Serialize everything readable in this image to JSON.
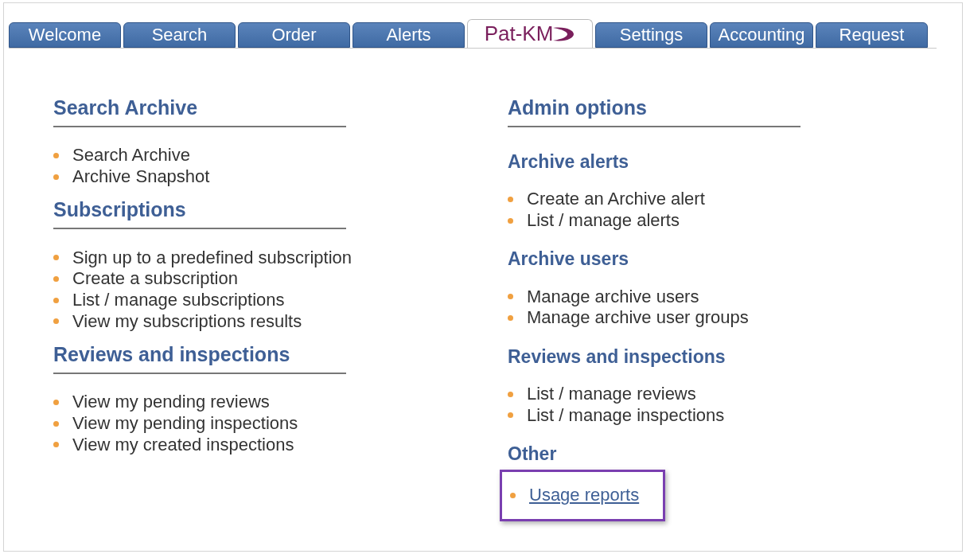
{
  "tabs": [
    {
      "label": "Welcome",
      "kind": "text",
      "selected": false
    },
    {
      "label": "Search",
      "kind": "text",
      "selected": false
    },
    {
      "label": "Order",
      "kind": "text",
      "selected": false
    },
    {
      "label": "Alerts",
      "kind": "text",
      "selected": false
    },
    {
      "label": "Pat-KM",
      "kind": "logo",
      "selected": true
    },
    {
      "label": "Settings",
      "kind": "text",
      "selected": false
    },
    {
      "label": "Accounting",
      "kind": "text",
      "selected": false
    },
    {
      "label": "Request",
      "kind": "text",
      "selected": false
    }
  ],
  "left_column": {
    "sections": [
      {
        "heading": "Search Archive",
        "items": [
          "Search Archive",
          "Archive Snapshot"
        ]
      },
      {
        "heading": "Subscriptions",
        "items": [
          "Sign up to a predefined subscription",
          "Create a subscription",
          "List / manage subscriptions",
          "View my subscriptions results"
        ]
      },
      {
        "heading": "Reviews and inspections",
        "items": [
          "View my pending reviews",
          "View my pending inspections",
          "View my created inspections"
        ]
      }
    ]
  },
  "right_column": {
    "heading": "Admin options",
    "groups": [
      {
        "heading": "Archive alerts",
        "items": [
          {
            "label": "Create an Archive alert",
            "link": false,
            "highlighted": false
          },
          {
            "label": "List / manage alerts",
            "link": false,
            "highlighted": false
          }
        ]
      },
      {
        "heading": "Archive users",
        "items": [
          {
            "label": "Manage archive users",
            "link": false,
            "highlighted": false
          },
          {
            "label": "Manage archive user groups",
            "link": false,
            "highlighted": false
          }
        ]
      },
      {
        "heading": "Reviews and inspections",
        "items": [
          {
            "label": "List / manage reviews",
            "link": false,
            "highlighted": false
          },
          {
            "label": "List / manage inspections",
            "link": false,
            "highlighted": false
          }
        ]
      },
      {
        "heading": "Other",
        "items": [
          {
            "label": "Usage reports",
            "link": true,
            "highlighted": true
          }
        ]
      }
    ]
  }
}
